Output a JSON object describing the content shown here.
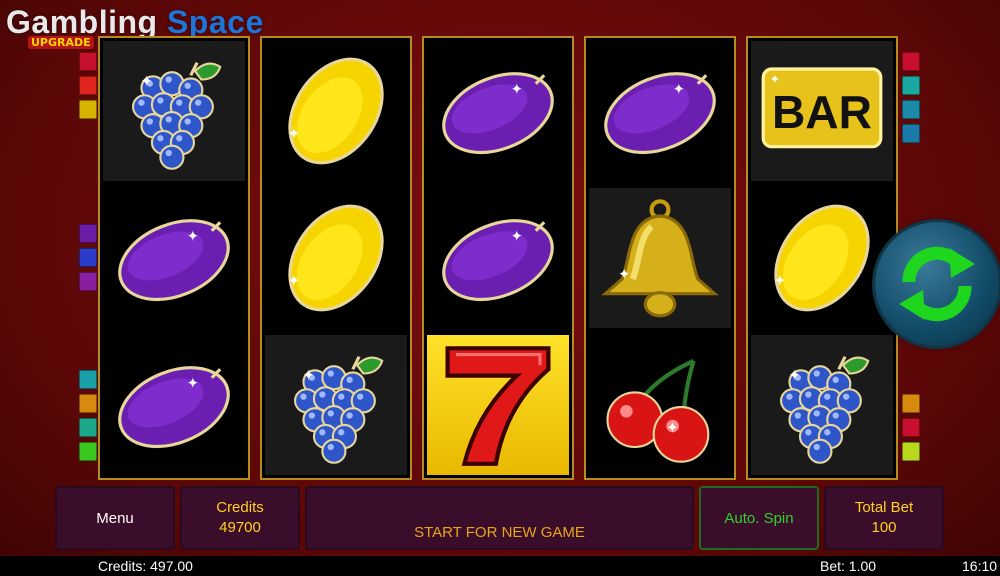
{
  "logo": {
    "word1": "Gambling",
    "word2": "Space",
    "badge": "UPGRADE"
  },
  "colors": {
    "reel_border": "#b58a1e",
    "win_cell": "#ffe22a",
    "label_yellow": "#ffd21f",
    "auto_spin_green": "#2fd12f",
    "button_bg": "#3a0d2a"
  },
  "reels": [
    {
      "symbols": [
        "grapes-icon",
        "plum-icon",
        "plum-icon"
      ]
    },
    {
      "symbols": [
        "lemon-icon",
        "lemon-icon",
        "grapes-icon"
      ]
    },
    {
      "symbols": [
        "plum-icon",
        "plum-icon",
        "seven-icon"
      ]
    },
    {
      "symbols": [
        "plum-icon",
        "bell-icon",
        "cherry-icon"
      ]
    },
    {
      "symbols": [
        "bar-icon",
        "lemon-icon",
        "grapes-icon"
      ]
    }
  ],
  "bar_symbol_text": "BAR",
  "spin_button_icon": "spin-arrows-icon",
  "controls": {
    "menu_label": "Menu",
    "credits_label": "Credits",
    "credits_value": "49700",
    "message": "START FOR NEW GAME",
    "auto_spin_label": "Auto. Spin",
    "total_bet_label": "Total Bet",
    "total_bet_value": "100"
  },
  "status": {
    "credits": "Credits: 497.00",
    "bet": "Bet: 1.00",
    "time": "16:10"
  }
}
